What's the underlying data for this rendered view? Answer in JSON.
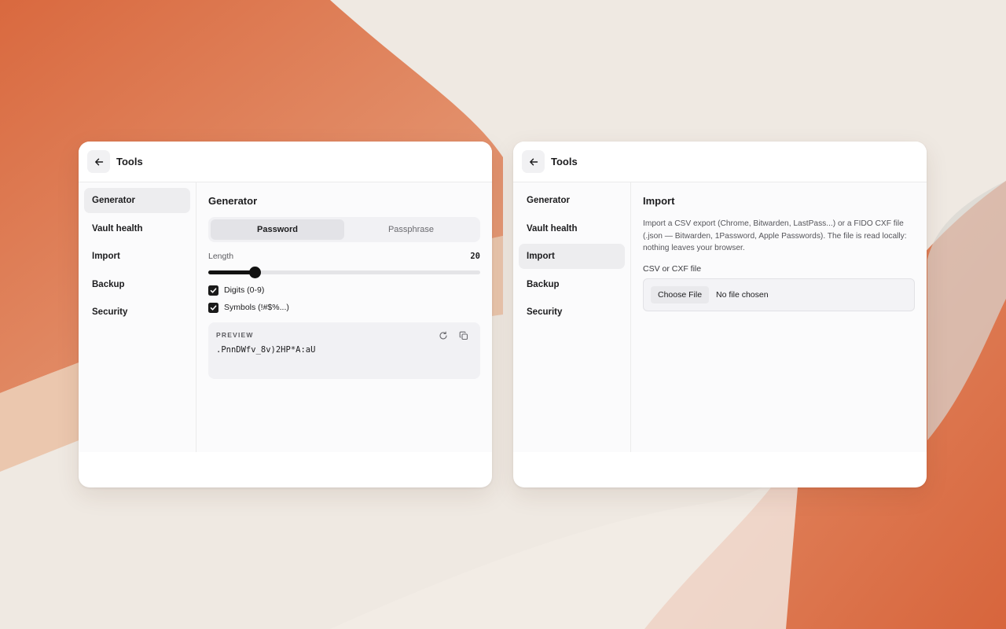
{
  "colors": {
    "accent": "#111111",
    "background_peach": "#d9734a",
    "window": "#ffffff"
  },
  "left_window": {
    "header": {
      "title": "Tools",
      "back_icon": "arrow-left-icon"
    },
    "sidebar": {
      "items": [
        {
          "label": "Generator",
          "active": true
        },
        {
          "label": "Vault health",
          "active": false
        },
        {
          "label": "Import",
          "active": false
        },
        {
          "label": "Backup",
          "active": false
        },
        {
          "label": "Security",
          "active": false
        }
      ]
    },
    "generator": {
      "title": "Generator",
      "tabs": [
        {
          "label": "Password",
          "active": true
        },
        {
          "label": "Passphrase",
          "active": false
        }
      ],
      "length_label": "Length",
      "length_value": "20",
      "length_slider_fraction": 0.17,
      "options": [
        {
          "label": "Digits (0-9)",
          "checked": true
        },
        {
          "label": "Symbols (!#$%...)",
          "checked": true
        }
      ],
      "preview": {
        "label": "PREVIEW",
        "value": ".PnnDWfv_8v)2HP*A:aU",
        "icons": [
          "refresh-icon",
          "copy-icon"
        ]
      }
    }
  },
  "right_window": {
    "header": {
      "title": "Tools",
      "back_icon": "arrow-left-icon"
    },
    "sidebar": {
      "items": [
        {
          "label": "Generator",
          "active": false
        },
        {
          "label": "Vault health",
          "active": false
        },
        {
          "label": "Import",
          "active": true
        },
        {
          "label": "Backup",
          "active": false
        },
        {
          "label": "Security",
          "active": false
        }
      ]
    },
    "import": {
      "title": "Import",
      "description": "Import a CSV export (Chrome, Bitwarden, LastPass...) or a FIDO CXF file (.json — Bitwarden, 1Password, Apple Passwords). The file is read locally: nothing leaves your browser.",
      "field_label": "CSV or CXF file",
      "choose_button": "Choose File",
      "file_status": "No file chosen"
    }
  }
}
